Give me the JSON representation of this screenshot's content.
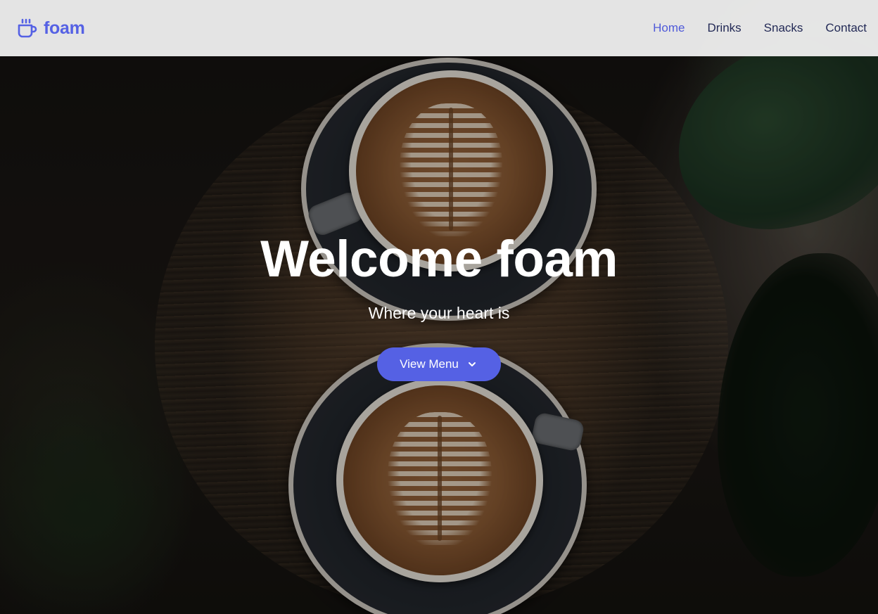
{
  "brand": {
    "name": "foam",
    "icon": "coffee-cup-icon",
    "color": "#5561e4"
  },
  "nav": {
    "items": [
      {
        "label": "Home",
        "active": true
      },
      {
        "label": "Drinks",
        "active": false
      },
      {
        "label": "Snacks",
        "active": false
      },
      {
        "label": "Contact",
        "active": false
      }
    ],
    "active_color": "#4f5ad9",
    "text_color": "#232a56"
  },
  "hero": {
    "title": "Welcome foam",
    "subtitle": "Where your heart is",
    "cta": {
      "label": "View Menu",
      "icon": "chevron-down-icon",
      "color": "#5561e4"
    }
  }
}
